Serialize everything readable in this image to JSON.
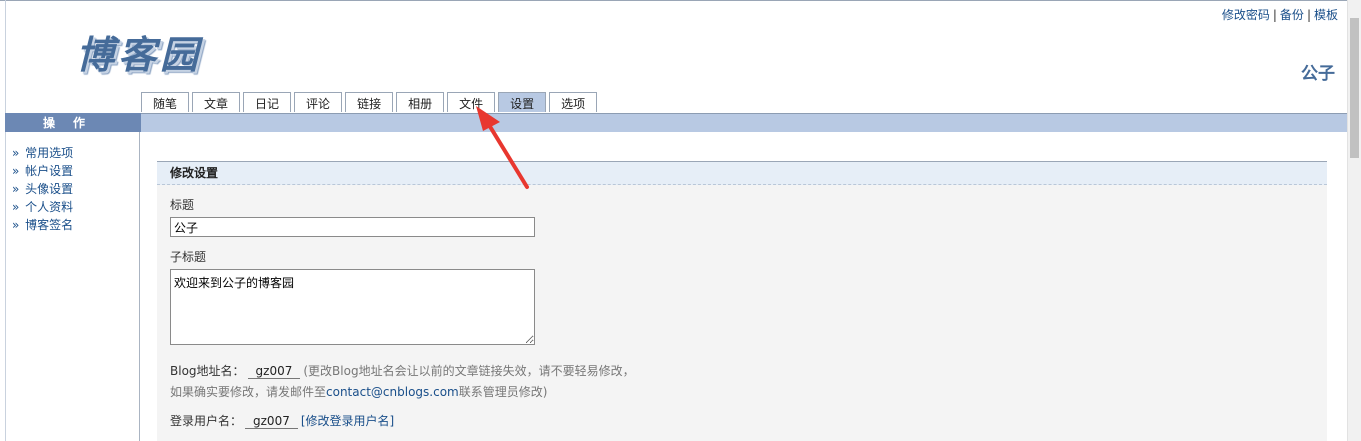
{
  "top_links": [
    "修改密码",
    "备份",
    "模板"
  ],
  "logo_text": "博客园",
  "blog_name": "公子",
  "tabs": [
    {
      "label": "随笔",
      "active": false
    },
    {
      "label": "文章",
      "active": false
    },
    {
      "label": "日记",
      "active": false
    },
    {
      "label": "评论",
      "active": false
    },
    {
      "label": "链接",
      "active": false
    },
    {
      "label": "相册",
      "active": false
    },
    {
      "label": "文件",
      "active": false
    },
    {
      "label": "设置",
      "active": true
    },
    {
      "label": "选项",
      "active": false
    }
  ],
  "sidebar": {
    "header": "操作",
    "bullet": "»",
    "items": [
      "常用选项",
      "帐户设置",
      "头像设置",
      "个人资料",
      "博客签名"
    ]
  },
  "form": {
    "section_title": "修改设置",
    "title_label": "标题",
    "title_value": "公子",
    "subtitle_label": "子标题",
    "subtitle_value": "欢迎来到公子的博客园",
    "blog_address_label": "Blog地址名：",
    "blog_address_value": "gz007",
    "blog_address_note_1": "(更改Blog地址名会让以前的文章链接失效，请不要轻易修改，",
    "blog_address_note_2a": "如果确实要修改，请发邮件至",
    "blog_address_note_email": "contact@cnblogs.com",
    "blog_address_note_2b": "联系管理员修改)",
    "login_label": "登录用户名：",
    "login_value": "gz007",
    "login_change_link": "[修改登录用户名]"
  },
  "colors": {
    "accent": "#456b99",
    "link": "#1a4f8a",
    "active_tab": "#b8c9e3",
    "sidebar_header": "#6c88b4",
    "annotation_arrow": "#e8372f"
  }
}
